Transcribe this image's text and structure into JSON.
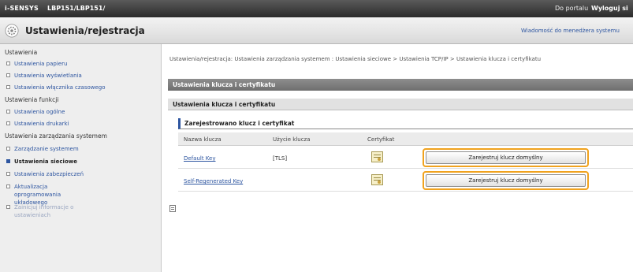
{
  "topbar": {
    "brand": "i-SENSYS",
    "model": "LBP151/LBP151/",
    "portal_link": "Do portalu",
    "logout_link": "Wyloguj si"
  },
  "titlebar": {
    "icon": "gear-icon",
    "title": "Ustawienia/rejestracja",
    "mail_link": "Wiadomość do menedżera systemu"
  },
  "sidebar": {
    "group1": "Ustawienia",
    "items1": [
      "Ustawienia papieru",
      "Ustawienia wyświetlania",
      "Ustawienia włącznika czasowego"
    ],
    "group2": "Ustawienia funkcji",
    "items2": [
      "Ustawienia ogólne",
      "Ustawienia drukarki"
    ],
    "group3": "Ustawienia zarządzania systemem",
    "items3": [
      "Zarządzanie systemem",
      "Ustawienia sieciowe",
      "Ustawienia zabezpieczeń",
      "Aktualizacja oprogramowania układowego",
      "Zainicjuj informacje o ustawieniach"
    ]
  },
  "breadcrumb": "Ustawienia/rejestracja: Ustawienia zarządzania systemem : Ustawienia sieciowe > Ustawienia TCP/IP > Ustawienia klucza i certyfikatu",
  "section_title": "Ustawienia klucza i certyfikatu",
  "subsection_title": "Ustawienia klucza i certyfikatu",
  "registered_title": "Zarejestrowano klucz i certyfikat",
  "table": {
    "headers": [
      "Nazwa klucza",
      "Użycie klucza",
      "Certyfikat"
    ],
    "rows": [
      {
        "key": "Default Key",
        "usage": "[TLS]",
        "button": "Zarejestruj klucz domyślny"
      },
      {
        "key": "Self-Regenerated Key",
        "usage": "",
        "button": "Zarejestruj klucz domyślny"
      }
    ]
  },
  "colors": {
    "accent": "#2d55a0",
    "highlight": "#f0a21e",
    "header_bar": "#6e6e6e"
  }
}
